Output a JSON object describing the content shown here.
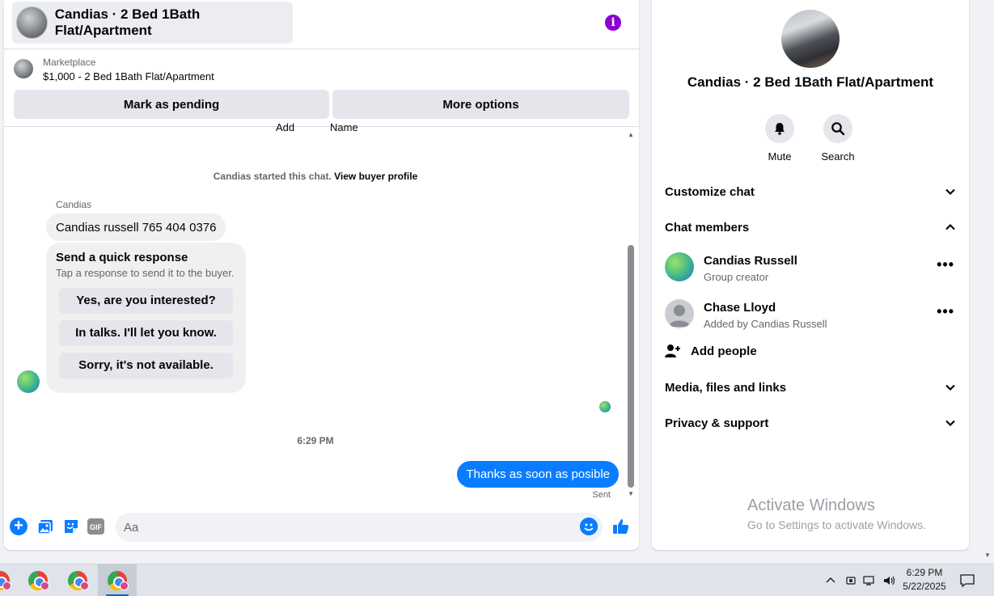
{
  "chat": {
    "title": "Candias · 2 Bed 1Bath Flat/Apartment",
    "info_icon": "i",
    "marketplace_label": "Marketplace",
    "listing": "$1,000 - 2 Bed 1Bath Flat/Apartment",
    "mark_pending": "Mark as pending",
    "more_options": "More options",
    "clipped_left": "Add",
    "clipped_right": "Name",
    "started_text": "Candias started this chat. ",
    "view_buyer": "View buyer profile",
    "sender_name": "Candias",
    "incoming_message": "Candias russell  765 404 0376",
    "quick_title": "Send a quick response",
    "quick_sub": "Tap a response to send it to the buyer.",
    "quick_responses": [
      "Yes, are you interested?",
      "In talks. I'll let you know.",
      "Sorry, it's not available."
    ],
    "timestamp": "6:29 PM",
    "outgoing_message": "Thanks as soon as posible",
    "sent_label": "Sent",
    "input_placeholder": "Aa",
    "gif_label": "GIF",
    "plus_label": "+"
  },
  "side": {
    "title": "Candias · 2 Bed 1Bath Flat/Apartment",
    "mute": "Mute",
    "search": "Search",
    "customize": "Customize chat",
    "members_header": "Chat members",
    "members": [
      {
        "name": "Candias Russell",
        "sub": "Group creator"
      },
      {
        "name": "Chase Lloyd",
        "sub": "Added by Candias Russell"
      }
    ],
    "dots": "•••",
    "add_people": "Add people",
    "media": "Media, files and links",
    "privacy": "Privacy & support"
  },
  "watermark": {
    "line1": "Activate Windows",
    "line2": "Go to Settings to activate Windows."
  },
  "taskbar": {
    "time": "6:29 PM",
    "date": "5/22/2025"
  },
  "colors": {
    "accent": "#0a7cff",
    "info": "#8a00d4"
  }
}
